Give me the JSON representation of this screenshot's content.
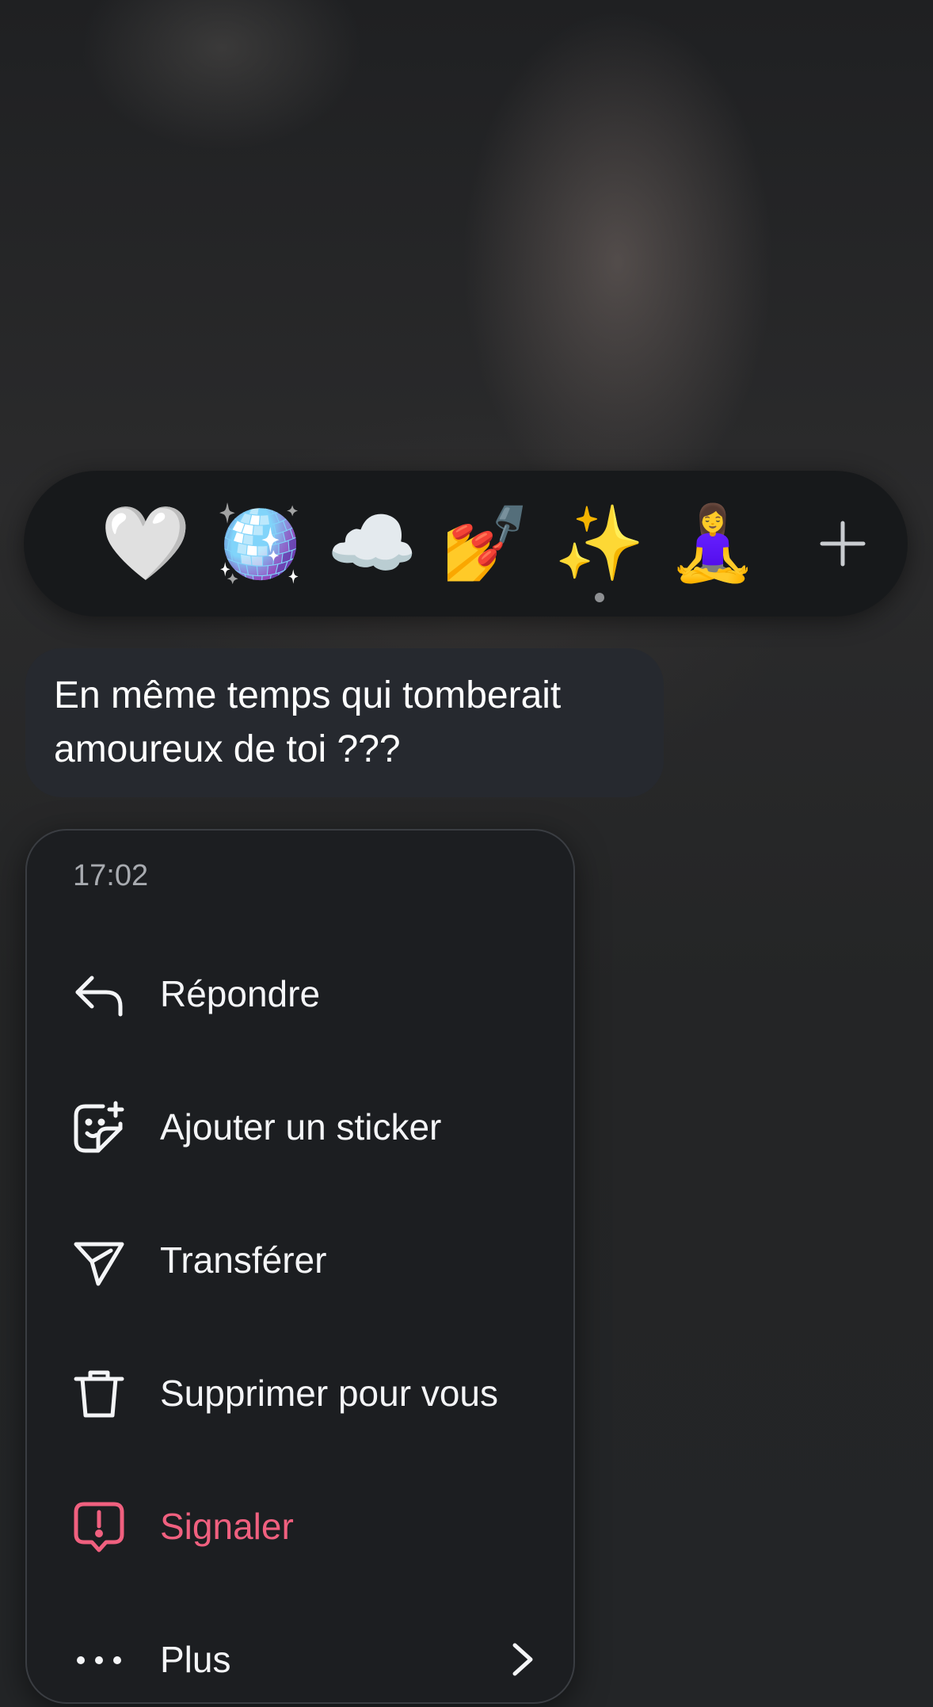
{
  "reaction_bar": {
    "emojis": [
      {
        "char": "🤍",
        "name": "white-heart"
      },
      {
        "char": "🪩",
        "name": "mirror-ball"
      },
      {
        "char": "☁️",
        "name": "cloud"
      },
      {
        "char": "💅",
        "name": "nail-polish"
      },
      {
        "char": "✨",
        "name": "sparkles"
      },
      {
        "char": "🧘‍♀️",
        "name": "woman-in-lotus-position"
      }
    ],
    "selected_index": 4,
    "add_icon": "plus-icon"
  },
  "message": {
    "text": "En même temps qui tomberait amoureux de toi ???"
  },
  "menu": {
    "timestamp": "17:02",
    "items": [
      {
        "label": "Répondre",
        "icon": "reply-icon"
      },
      {
        "label": "Ajouter un sticker",
        "icon": "add-sticker-icon"
      },
      {
        "label": "Transférer",
        "icon": "forward-icon"
      },
      {
        "label": "Supprimer pour vous",
        "icon": "trash-icon"
      },
      {
        "label": "Signaler",
        "icon": "report-icon",
        "color": "#f0607f"
      },
      {
        "label": "Plus",
        "icon": "more-icon"
      }
    ]
  }
}
